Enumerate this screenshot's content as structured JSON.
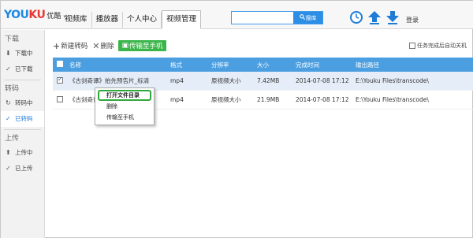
{
  "app": {
    "logo_en": "YOUKU",
    "logo_cn": "优酷",
    "tabs": [
      {
        "label": "视频库"
      },
      {
        "label": "播放器"
      },
      {
        "label": "个人中心"
      },
      {
        "label": "视频管理",
        "active": true
      }
    ],
    "search": {
      "value": "",
      "placeholder": "",
      "button": "搜库"
    },
    "login": "登录",
    "icons": [
      "clock-icon",
      "upload-icon",
      "download-icon"
    ],
    "accent_color": "#2d8ee6"
  },
  "sidebar": {
    "sections": [
      {
        "title": "下载",
        "items": [
          {
            "label": "下载中",
            "icon": "download-arrow-icon"
          },
          {
            "label": "已下载",
            "icon": "check-icon"
          }
        ]
      },
      {
        "title": "转码",
        "items": [
          {
            "label": "转码中",
            "icon": "refresh-icon"
          },
          {
            "label": "已转码",
            "icon": "check-icon",
            "active": true
          }
        ]
      },
      {
        "title": "上传",
        "items": [
          {
            "label": "上传中",
            "icon": "upload-arrow-icon"
          },
          {
            "label": "已上传",
            "icon": "check-icon"
          }
        ]
      }
    ]
  },
  "toolbar": {
    "new_transcode": "新建转码",
    "delete": "删除",
    "transfer_to_phone": "传输至手机",
    "auto_close": "任务完成后自动关机"
  },
  "table": {
    "headers": [
      "名称",
      "格式",
      "分辨率",
      "大小",
      "完成时间",
      "输出路径"
    ],
    "rows": [
      {
        "checked": true,
        "name": "《古剑奇谭》拍先预告片_标清",
        "format": "mp4",
        "resolution": "原视频大小",
        "size": "7.42MB",
        "finished": "2014-07-08 17:12",
        "path": "E:\\Youku Files\\transcode\\"
      },
      {
        "checked": false,
        "name": "《古剑奇谭》拍先预告片_标清",
        "format": "mp4",
        "resolution": "原视频大小",
        "size": "21.9MB",
        "finished": "2014-07-08 17:12",
        "path": "E:\\Youku Files\\transcode\\"
      }
    ]
  },
  "context_menu": {
    "items": [
      "打开文件目录",
      "删除",
      "传输至手机"
    ]
  }
}
